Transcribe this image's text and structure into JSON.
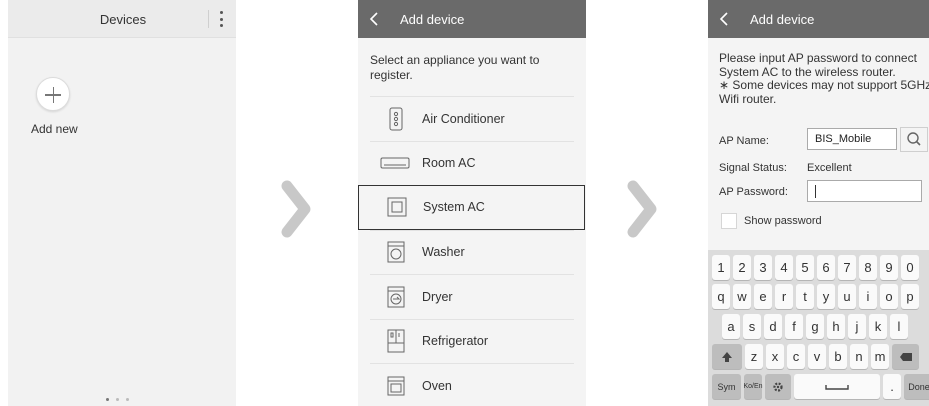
{
  "screen1": {
    "title": "Devices",
    "add_label": "Add new"
  },
  "screen2": {
    "title": "Add device",
    "intro": "Select an appliance you want to register.",
    "items": [
      {
        "label": "Air Conditioner",
        "icon": "air-conditioner-icon"
      },
      {
        "label": "Room AC",
        "icon": "room-ac-icon"
      },
      {
        "label": "System AC",
        "icon": "system-ac-icon",
        "selected": true
      },
      {
        "label": "Washer",
        "icon": "washer-icon"
      },
      {
        "label": "Dryer",
        "icon": "dryer-icon"
      },
      {
        "label": "Refrigerator",
        "icon": "refrigerator-icon"
      },
      {
        "label": "Oven",
        "icon": "oven-icon"
      }
    ]
  },
  "screen3": {
    "title": "Add device",
    "note_line1": "Please input AP password to connect System AC to the wireless router.",
    "note_line2": "∗ Some devices may not support 5GHz Wifi router.",
    "ap_name_label": "AP Name:",
    "ap_name_value": "BIS_Mobile",
    "signal_label": "Signal Status:",
    "signal_value": "Excellent",
    "password_label": "AP Password:",
    "password_value": "",
    "show_password": "Show password",
    "keyboard": {
      "row1": [
        "1",
        "2",
        "3",
        "4",
        "5",
        "6",
        "7",
        "8",
        "9",
        "0"
      ],
      "row2": [
        "q",
        "w",
        "e",
        "r",
        "t",
        "y",
        "u",
        "i",
        "o",
        "p"
      ],
      "row3": [
        "a",
        "s",
        "d",
        "f",
        "g",
        "h",
        "j",
        "k",
        "l"
      ],
      "row4": [
        "z",
        "x",
        "c",
        "v",
        "b",
        "n",
        "m"
      ],
      "sym": "Sym",
      "lang": "Ko/En",
      "dot": ".",
      "done": "Done"
    }
  },
  "colors": {
    "header_dark": "#6a6a6a",
    "arrow": "#c8c8c8",
    "background": "#f4f4f4"
  }
}
